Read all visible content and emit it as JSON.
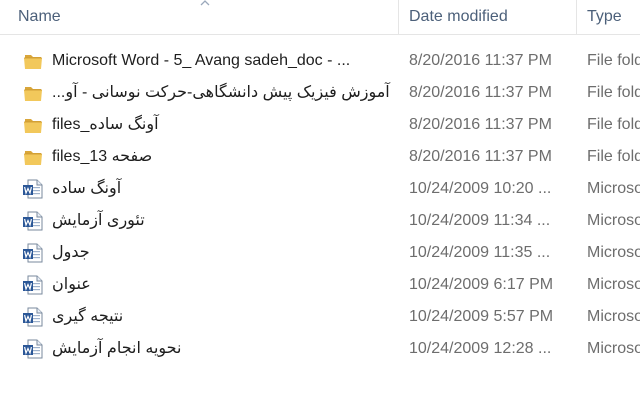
{
  "columns": {
    "name": "Name",
    "date_modified": "Date modified",
    "type": "Type"
  },
  "files": [
    {
      "name": "Microsoft Word - 5_ Avang sadeh_doc - ...",
      "date": "8/20/2016 11:37 PM",
      "type": "File folder",
      "icon": "folder-icon",
      "rtl": false
    },
    {
      "name": "آموزش فیزیک پیش دانشگاهی-حرکت نوسانی - آو...",
      "date": "8/20/2016 11:37 PM",
      "type": "File folder",
      "icon": "folder-icon",
      "rtl": true
    },
    {
      "name": "آونگ ساده_files",
      "date": "8/20/2016 11:37 PM",
      "type": "File folder",
      "icon": "folder-icon",
      "rtl": true
    },
    {
      "name": "صفحه 13_files",
      "date": "8/20/2016 11:37 PM",
      "type": "File folder",
      "icon": "folder-icon",
      "rtl": true
    },
    {
      "name": "آونگ ساده",
      "date": "10/24/2009 10:20 ...",
      "type": "Microsoft",
      "icon": "word-document-icon",
      "rtl": true
    },
    {
      "name": "تئوری آزمایش",
      "date": "10/24/2009 11:34 ...",
      "type": "Microsoft",
      "icon": "word-document-icon",
      "rtl": true
    },
    {
      "name": "جدول",
      "date": "10/24/2009 11:35 ...",
      "type": "Microsoft",
      "icon": "word-document-icon",
      "rtl": true
    },
    {
      "name": "عنوان",
      "date": "10/24/2009 6:17 PM",
      "type": "Microsoft",
      "icon": "word-document-icon",
      "rtl": true
    },
    {
      "name": "نتیجه گیری",
      "date": "10/24/2009 5:57 PM",
      "type": "Microsoft",
      "icon": "word-document-icon",
      "rtl": true
    },
    {
      "name": "نحویه انجام آزمایش",
      "date": "10/24/2009 12:28 ...",
      "type": "Microsoft",
      "icon": "word-document-icon",
      "rtl": true
    }
  ],
  "colors": {
    "header_text": "#4c607a",
    "folder_yellow": "#e8b84a",
    "word_blue": "#2b5797"
  }
}
